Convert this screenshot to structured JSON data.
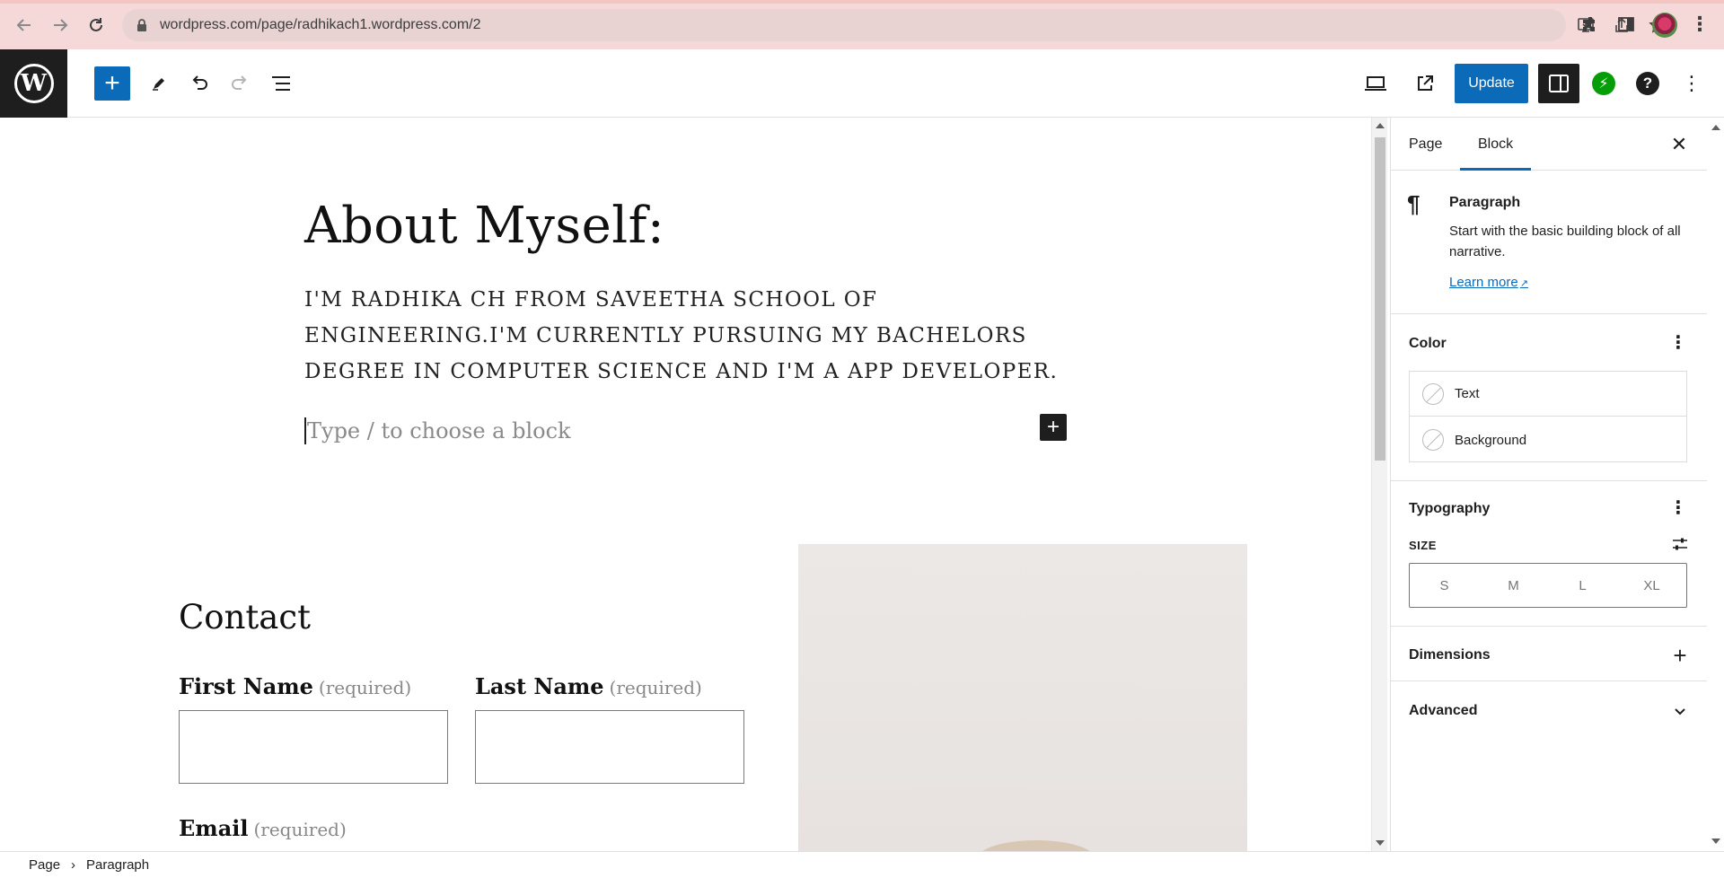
{
  "browser": {
    "url": "wordpress.com/page/radhikach1.wordpress.com/2"
  },
  "toolbar": {
    "update_label": "Update"
  },
  "editor": {
    "title": "About Myself:",
    "paragraph": "I'M RADHIKA CH FROM SAVEETHA SCHOOL OF ENGINEERING.I'M CURRENTLY PURSUING MY BACHELORS DEGREE IN COMPUTER SCIENCE AND I'M A APP DEVELOPER.",
    "block_placeholder": "Type / to choose a block",
    "contact_title": "Contact",
    "fields": {
      "first_name": "First Name",
      "last_name": "Last Name",
      "email": "Email",
      "required": "(required)"
    }
  },
  "sidebar": {
    "tabs": [
      "Page",
      "Block"
    ],
    "active_tab": "Block",
    "block": {
      "name": "Paragraph",
      "description": "Start with the basic building block of all narrative.",
      "learn_more": "Learn more"
    },
    "color": {
      "title": "Color",
      "items": [
        "Text",
        "Background"
      ]
    },
    "typography": {
      "title": "Typography",
      "size_label": "SIZE",
      "sizes": [
        "S",
        "M",
        "L",
        "XL"
      ]
    },
    "dimensions": {
      "title": "Dimensions"
    },
    "advanced": {
      "title": "Advanced"
    }
  },
  "breadcrumb": [
    "Page",
    "Paragraph"
  ],
  "colors": {
    "accent": "#0c6bb8",
    "chrome_bg": "#f5d9d9",
    "dark": "#1e1e1e",
    "jetpack": "#069e08"
  }
}
